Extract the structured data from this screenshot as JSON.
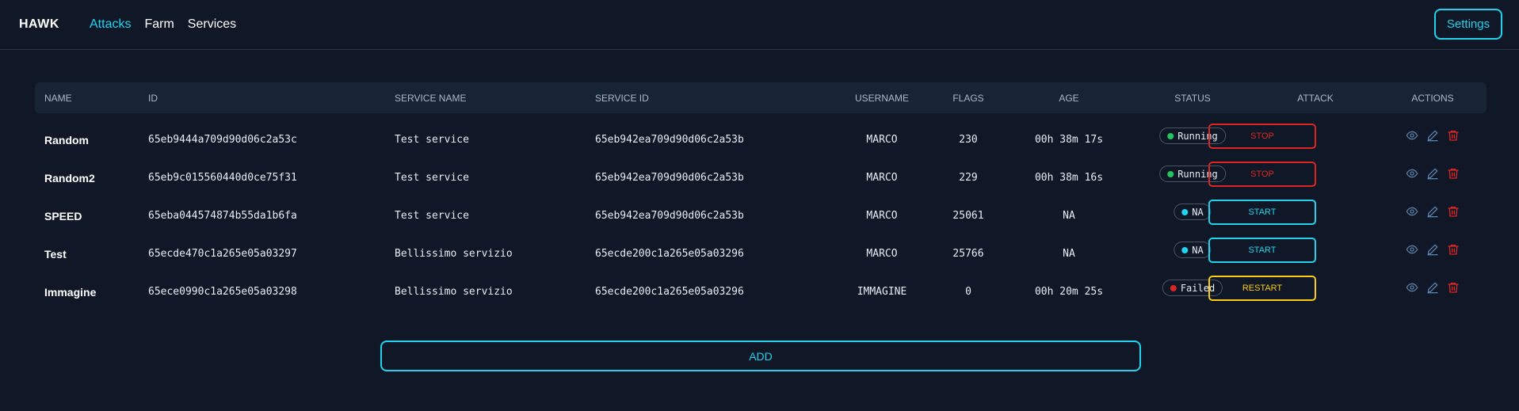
{
  "app": {
    "brand": "HAWK"
  },
  "nav": {
    "attacks": "Attacks",
    "farm": "Farm",
    "services": "Services"
  },
  "settings_label": "Settings",
  "columns": {
    "name": "NAME",
    "id": "ID",
    "service_name": "SERVICE NAME",
    "service_id": "SERVICE ID",
    "username": "USERNAME",
    "flags": "FLAGS",
    "age": "AGE",
    "status": "STATUS",
    "attack": "ATTACK",
    "actions": "ACTIONS"
  },
  "rows": [
    {
      "name": "Random",
      "id": "65eb9444a709d90d06c2a53c",
      "service_name": "Test service",
      "service_id": "65eb942ea709d90d06c2a53b",
      "username": "MARCO",
      "flags": "230",
      "age": "00h 38m 17s",
      "status": "Running",
      "status_color": "#22c55e",
      "attack": "STOP",
      "attack_color": "#dc2626"
    },
    {
      "name": "Random2",
      "id": "65eb9c015560440d0ce75f31",
      "service_name": "Test service",
      "service_id": "65eb942ea709d90d06c2a53b",
      "username": "MARCO",
      "flags": "229",
      "age": "00h 38m 16s",
      "status": "Running",
      "status_color": "#22c55e",
      "attack": "STOP",
      "attack_color": "#dc2626"
    },
    {
      "name": "SPEED",
      "id": "65eba044574874b55da1b6fa",
      "service_name": "Test service",
      "service_id": "65eb942ea709d90d06c2a53b",
      "username": "MARCO",
      "flags": "25061",
      "age": "NA",
      "status": "NA",
      "status_color": "#22d3ee",
      "attack": "START",
      "attack_color": "#22d3ee"
    },
    {
      "name": "Test",
      "id": "65ecde470c1a265e05a03297",
      "service_name": "Bellissimo servizio",
      "service_id": "65ecde200c1a265e05a03296",
      "username": "MARCO",
      "flags": "25766",
      "age": "NA",
      "status": "NA",
      "status_color": "#22d3ee",
      "attack": "START",
      "attack_color": "#22d3ee"
    },
    {
      "name": "Immagine",
      "id": "65ece0990c1a265e05a03298",
      "service_name": "Bellissimo servizio",
      "service_id": "65ecde200c1a265e05a03296",
      "username": "IMMAGINE",
      "flags": "0",
      "age": "00h 20m 25s",
      "status": "Failed",
      "status_color": "#dc2626",
      "attack": "RESTART",
      "attack_color": "#facc15"
    }
  ],
  "icons": {
    "view": "eye-icon",
    "edit": "pencil-icon",
    "delete": "trash-icon"
  },
  "colors": {
    "accent": "#22d3ee",
    "danger": "#dc2626",
    "success": "#22c55e",
    "warning": "#facc15",
    "background": "#101827"
  },
  "add_label": "ADD"
}
